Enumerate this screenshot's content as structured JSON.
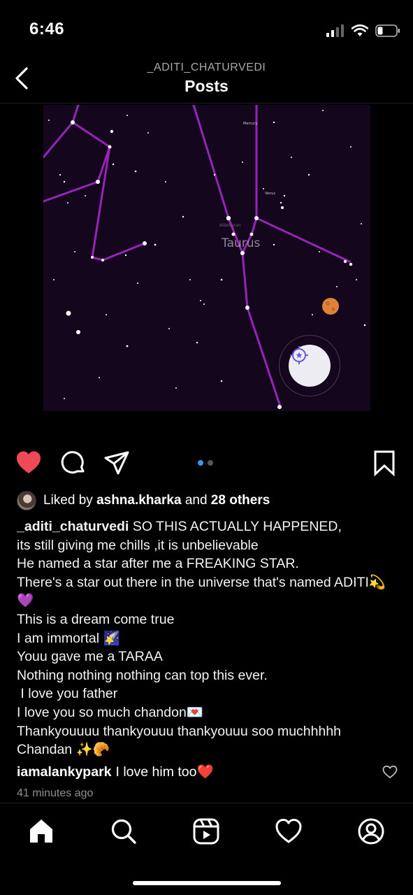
{
  "status_bar": {
    "time": "6:46",
    "icons": [
      "signal-icon",
      "wifi-icon",
      "battery-icon"
    ]
  },
  "nav": {
    "username": "_ADITI_CHATURVEDI",
    "title": "Posts",
    "back_icon": "chevron-left-icon"
  },
  "post": {
    "image": {
      "constellation_label": "Taurus",
      "planet_labels": [
        "Mercury",
        "Venus"
      ],
      "star_label": "Aldebaran",
      "locate_icon": "star-locate-icon"
    },
    "carousel": {
      "count": 2,
      "active_index": 0
    },
    "actions": [
      "heart-filled-icon",
      "comment-icon",
      "share-icon",
      "bookmark-icon"
    ],
    "likes": {
      "prefix": "Liked by",
      "user": "ashna.kharka",
      "joiner": "and",
      "others": "28 others"
    },
    "caption": {
      "user": "_aditi_chaturvedi",
      "text": " SO THIS ACTUALLY HAPPENED,\nits still giving me chills ,it is unbelievable\nHe named a star after me a FREAKING STAR.\nThere's a star out there in the universe that's named ADITI💫 💜\nThis is a dream come true\nI am immortal 🌠\nYouu gave me a TARAA\nNothing nothing nothing can top this ever.\n I love you father\nI love you so much chandon💌\nThankyouuuu thankyouuu thankyouuu soo muchhhhh\nChandan ✨🥐"
    },
    "comment": {
      "user": "iamalankypark",
      "text": "I love him too❤️"
    },
    "timestamp": "41 minutes ago"
  },
  "tabbar": [
    "home-icon",
    "search-icon",
    "reels-icon",
    "activity-heart-icon",
    "profile-icon"
  ],
  "colors": {
    "background": "#000000",
    "like_red": "#ed4956",
    "dot_active": "#3897f0",
    "dot_inactive": "#555555",
    "sky": "#13051b",
    "constellation": "#a428c8",
    "muted": "#8e8e8e"
  }
}
